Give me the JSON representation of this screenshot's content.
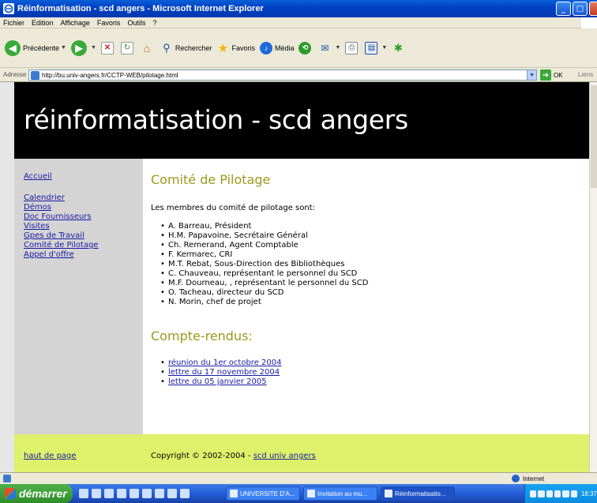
{
  "window": {
    "title": "Réinformatisation - scd angers - Microsoft Internet Explorer",
    "controls": [
      "_",
      "□",
      "X"
    ]
  },
  "menu": [
    "Fichier",
    "Edition",
    "Affichage",
    "Favoris",
    "Outils",
    "?"
  ],
  "toolbar": {
    "back_label": "Précédente",
    "search_label": "Rechercher",
    "favorites_label": "Favoris",
    "media_label": "Média"
  },
  "address": {
    "label": "Adresse",
    "url": "http://bu.univ-angers.fr/CCTP-WEB/pilotage.html",
    "go_label": "OK",
    "links_label": "Liens"
  },
  "page": {
    "banner_title": "réinformatisation - scd angers",
    "nav": {
      "home": "Accueil",
      "items": [
        "Calendrier",
        "Démos",
        "Doc Fournisseurs",
        "Visites",
        "Gpes de Travail",
        "Comité de Pilotage",
        "Appel d'offre"
      ]
    },
    "heading": "Comité de Pilotage",
    "intro": "Les membres du comité de pilotage sont:",
    "members": [
      "A. Barreau, Président",
      "H.M. Papavoine, Secrétaire Général",
      "Ch. Remerand, Agent Comptable",
      "F. Kermarec, CRI",
      "M.T. Rebat, Sous-Direction des Bibliothèques",
      "C. Chauveau, représentant le personnel du SCD",
      "M.F. Dourneau, , représentant le personnel du SCD",
      "O. Tacheau, directeur du SCD",
      "N. Morin, chef de projet"
    ],
    "reports_heading": "Compte-rendus:",
    "reports": [
      "réunion du 1er octobre 2004",
      "lettre du 17 novembre 2004",
      "lettre du 05 janvier 2005"
    ],
    "footer": {
      "top_link": "haut de page",
      "copyright": "Copyright © 2002-2004 - ",
      "copyright_link": "scd univ angers"
    }
  },
  "status": {
    "zone": "Internet"
  },
  "taskbar": {
    "start_label": "démarrer",
    "tasks": [
      "UNIVERSITE D'A...",
      "Invitation au mu...",
      "Réinformatisatio..."
    ],
    "clock": "18:37"
  },
  "colors": {
    "banner_bg": "#000000",
    "sidebar_bg": "#d4d4d4",
    "footer_bg": "#ddf26a",
    "heading": "#9a9a1e",
    "link": "#1a1aa6"
  }
}
